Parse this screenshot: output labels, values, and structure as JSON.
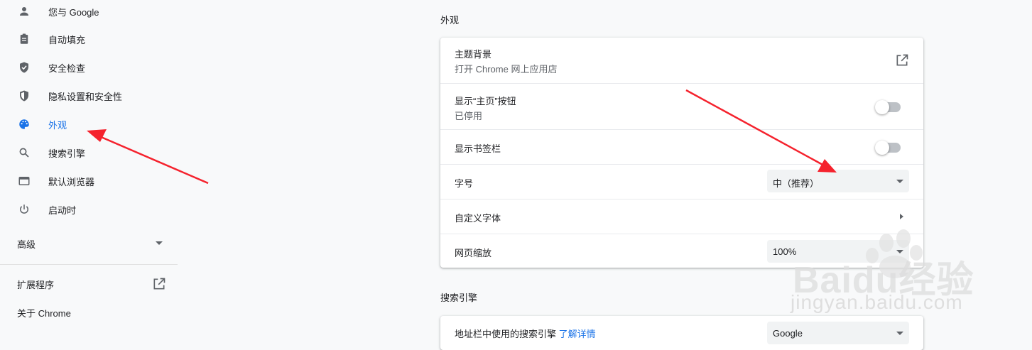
{
  "sidebar": {
    "items": [
      {
        "label": "您与 Google",
        "icon": "person-icon"
      },
      {
        "label": "自动填充",
        "icon": "clipboard-icon"
      },
      {
        "label": "安全检查",
        "icon": "shield-check-icon"
      },
      {
        "label": "隐私设置和安全性",
        "icon": "shield-half-icon"
      },
      {
        "label": "外观",
        "icon": "palette-icon",
        "active": true
      },
      {
        "label": "搜索引擎",
        "icon": "search-icon"
      },
      {
        "label": "默认浏览器",
        "icon": "browser-window-icon"
      },
      {
        "label": "启动时",
        "icon": "power-icon"
      }
    ],
    "advanced_label": "高级",
    "extensions_label": "扩展程序",
    "about_label": "关于 Chrome"
  },
  "appearance": {
    "section_title": "外观",
    "theme": {
      "title": "主题背景",
      "subtitle": "打开 Chrome 网上应用店"
    },
    "home_button": {
      "title": "显示“主页”按钮",
      "subtitle": "已停用",
      "enabled": false
    },
    "bookmarks_bar": {
      "title": "显示书签栏",
      "enabled": false
    },
    "font_size": {
      "title": "字号",
      "value": "中（推荐）"
    },
    "custom_fonts": {
      "title": "自定义字体"
    },
    "page_zoom": {
      "title": "网页缩放",
      "value": "100%"
    }
  },
  "search_engine": {
    "section_title": "搜索引擎",
    "row_title": "地址栏中使用的搜索引擎",
    "learn_more": "了解详情",
    "value": "Google"
  },
  "watermark": {
    "brand": "Baidu经验",
    "url": "jingyan.baidu.com"
  },
  "colors": {
    "accent": "#1a73e8",
    "arrow": "#f5222d",
    "background": "#f8f9fa"
  }
}
